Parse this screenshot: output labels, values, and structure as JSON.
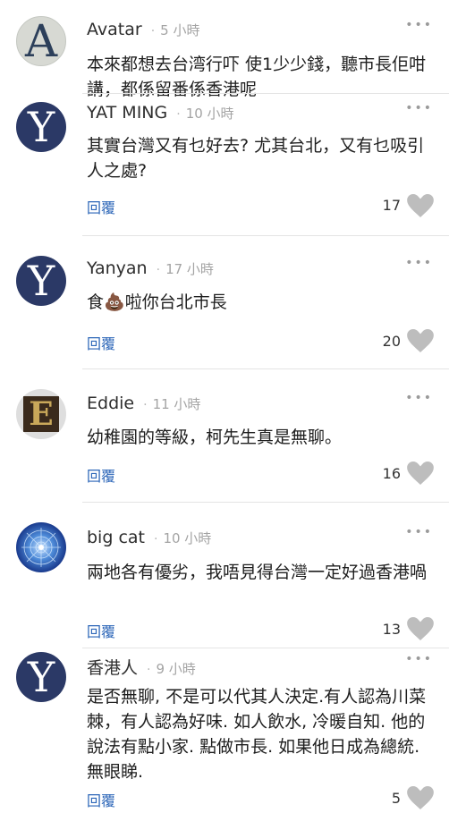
{
  "comments": [
    {
      "name": "Avatar",
      "time": "5 小時",
      "text": "本來都想去台湾行吓 使1少少錢，聽市長佢咁講，都係留番係香港呢",
      "reply": "",
      "likes": "",
      "avatar": "A"
    },
    {
      "name": "YAT MING",
      "time": "10 小時",
      "text": "其實台灣又有乜好去? 尤其台北，又有乜吸引人之處?",
      "reply": "回覆",
      "likes": "17",
      "avatar": "Y"
    },
    {
      "name": "Yanyan",
      "time": "17 小時",
      "text_before": "食",
      "emoji": "💩",
      "text_after": "啦你台北市長",
      "reply": "回覆",
      "likes": "20",
      "avatar": "Y"
    },
    {
      "name": "Eddie",
      "time": "11 小時",
      "text": "幼稚園的等級，柯先生真是無聊。",
      "reply": "回覆",
      "likes": "16",
      "avatar": "E"
    },
    {
      "name": "big cat",
      "time": "10 小時",
      "text": "兩地各有優劣，我唔見得台灣一定好過香港喎",
      "reply": "回覆",
      "likes": "13",
      "avatar": ""
    },
    {
      "name": "香港人",
      "time": "9 小時",
      "text": "是否無聊, 不是可以代其人決定.有人認為川菜棘，有人認為好味. 如人飲水, 冷暖自知. 他的說法有點小家. 點做市長. 如果他日成為總統. 無眼睇.",
      "reply": "回覆",
      "likes": "5",
      "avatar": "Y"
    }
  ],
  "ui": {
    "dot": "·",
    "more": "•••"
  },
  "colors": {
    "accent": "#2c66b8",
    "heart": "#bdbdbd",
    "avatar_navy": "#2b3966"
  }
}
